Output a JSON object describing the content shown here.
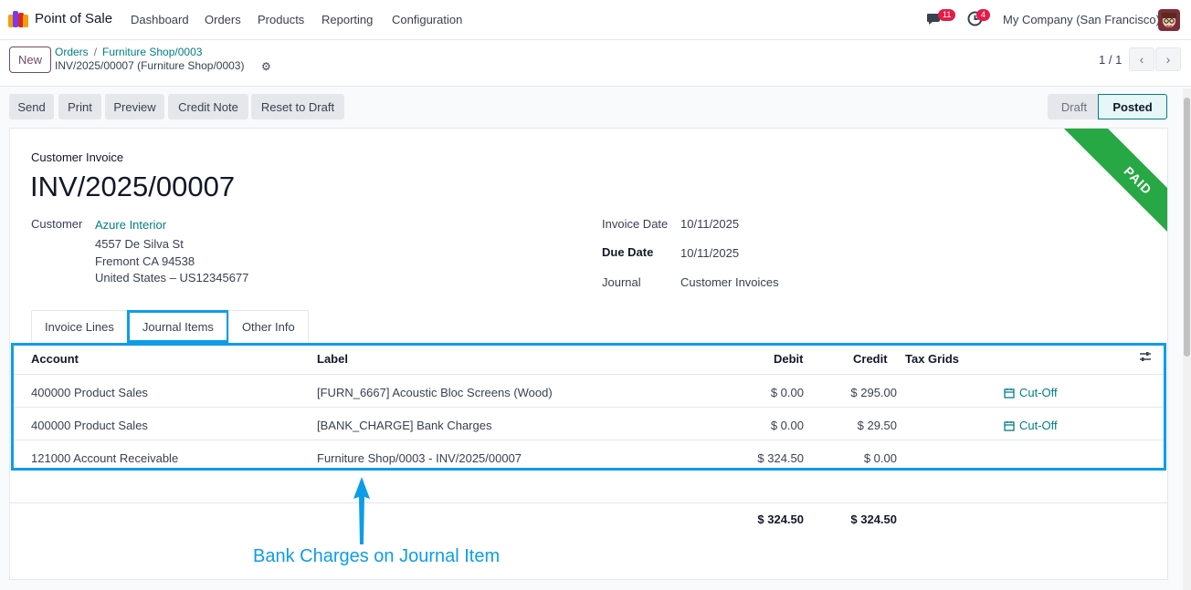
{
  "app": {
    "name": "Point of Sale"
  },
  "menu": [
    "Dashboard",
    "Orders",
    "Products",
    "Reporting",
    "Configuration"
  ],
  "nav": {
    "messages_badge": "11",
    "activities_badge": "4",
    "company": "My Company (San Francisco)"
  },
  "control": {
    "new_label": "New",
    "breadcrumb": [
      "Orders",
      "Furniture Shop/0003"
    ],
    "record_name": "INV/2025/00007 (Furniture Shop/0003)",
    "pager": "1 / 1"
  },
  "actions": [
    "Send",
    "Print",
    "Preview",
    "Credit Note",
    "Reset to Draft"
  ],
  "status": {
    "draft": "Draft",
    "posted": "Posted",
    "current": "Posted"
  },
  "ribbon": "PAID",
  "invoice": {
    "type_label": "Customer Invoice",
    "number": "INV/2025/00007",
    "customer_label": "Customer",
    "customer_name": "Azure Interior",
    "address": [
      "4557 De Silva St",
      "Fremont CA 94538",
      "United States – US12345677"
    ],
    "invoice_date_label": "Invoice Date",
    "invoice_date": "10/11/2025",
    "due_date_label": "Due Date",
    "due_date": "10/11/2025",
    "journal_label": "Journal",
    "journal": "Customer Invoices"
  },
  "tabs": [
    "Invoice Lines",
    "Journal Items",
    "Other Info"
  ],
  "active_tab": "Journal Items",
  "journal_items": {
    "headers": {
      "account": "Account",
      "label": "Label",
      "debit": "Debit",
      "credit": "Credit",
      "tax_grids": "Tax Grids"
    },
    "rows": [
      {
        "account": "400000 Product Sales",
        "label": "[FURN_6667] Acoustic Bloc Screens (Wood)",
        "debit": "$ 0.00",
        "credit": "$ 295.00",
        "action": "Cut-Off"
      },
      {
        "account": "400000 Product Sales",
        "label": "[BANK_CHARGE] Bank Charges",
        "debit": "$ 0.00",
        "credit": "$ 29.50",
        "action": "Cut-Off"
      },
      {
        "account": "121000 Account Receivable",
        "label": "Furniture Shop/0003 - INV/2025/00007",
        "debit": "$ 324.50",
        "credit": "$ 0.00",
        "action": ""
      }
    ],
    "totals": {
      "debit": "$ 324.50",
      "credit": "$ 324.50"
    }
  },
  "annotation": "Bank Charges on Journal Item",
  "colors": {
    "accent": "#017e84",
    "brand": "#714b67",
    "highlight": "#0d9de8",
    "paid": "#28a745"
  }
}
